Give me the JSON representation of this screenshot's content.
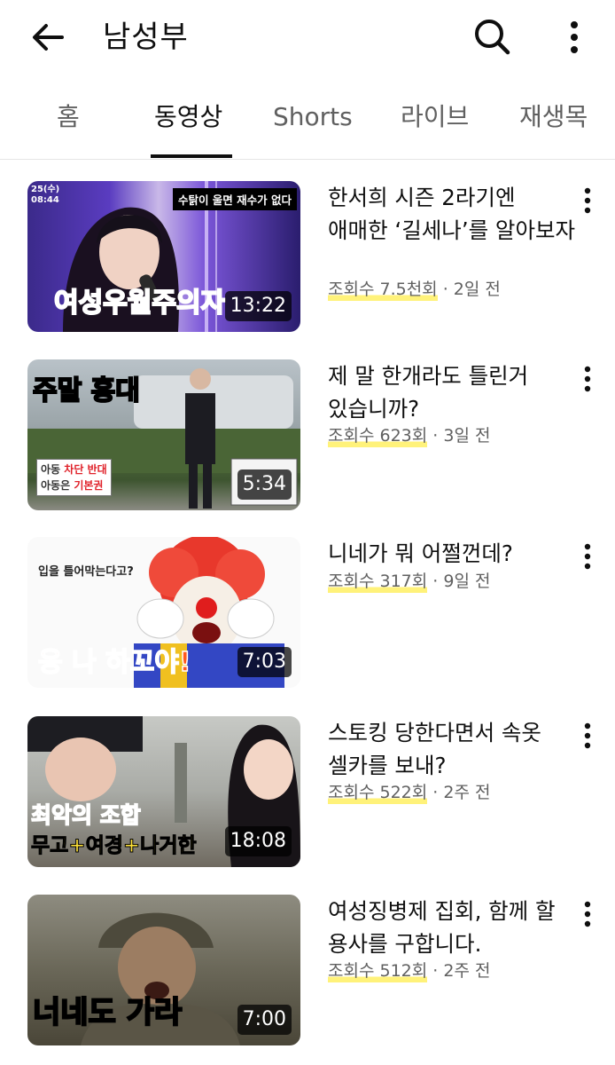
{
  "header": {
    "channel_name": "남성부",
    "back_icon": "arrow-left-icon",
    "search_icon": "search-icon",
    "more_icon": "more-vert-icon"
  },
  "tabs": [
    {
      "label": "홈",
      "active": false
    },
    {
      "label": "동영상",
      "active": true
    },
    {
      "label": "Shorts",
      "active": false
    },
    {
      "label": "라이브",
      "active": false
    },
    {
      "label": "재생목",
      "active": false
    }
  ],
  "videos": [
    {
      "title": "한서희 시즌 2라기엔 애매한 ‘길세나’를 알아보자",
      "views": "조회수 7.5천회",
      "age": "· 2일 전",
      "duration": "13:22",
      "thumb_caption": "여성우월주의자",
      "thumb_top_caption": "수탉이 울면 재수가 없다",
      "thumb_corner": "25(수)\n08:44"
    },
    {
      "title": "제 말 한개라도 틀린거 있습니까?",
      "views": "조회수 623회",
      "age": "· 3일 전",
      "duration": "5:34",
      "thumb_caption": "주말 홍대",
      "thumb_sign_line1_a": "아동",
      "thumb_sign_line1_b": "차단 반대",
      "thumb_sign_line2_a": "아동은",
      "thumb_sign_line2_b": "기본권"
    },
    {
      "title": "니네가 뭐 어쩔껀데?",
      "views": "조회수 317회",
      "age": "· 9일 전",
      "duration": "7:03",
      "thumb_caption": "응 나 하꼬야!",
      "thumb_top_caption": "입을 틀어막는다고?"
    },
    {
      "title": "스토킹 당한다면서 속옷 셀카를 보내?",
      "views": "조회수 522회",
      "age": "· 2주 전",
      "duration": "18:08",
      "thumb_caption": "최악의 조합",
      "thumb_caption2": "무고+여경+나거한"
    },
    {
      "title": "여성징병제 집회, 함께 할 용사를 구합니다.",
      "views": "조회수 512회",
      "age": "· 2주 전",
      "duration": "7:00",
      "thumb_caption": "너네도 가라"
    }
  ],
  "colors": {
    "view_highlight": "#fff27a",
    "text_primary": "#0f0f0f",
    "text_secondary": "#606060"
  }
}
